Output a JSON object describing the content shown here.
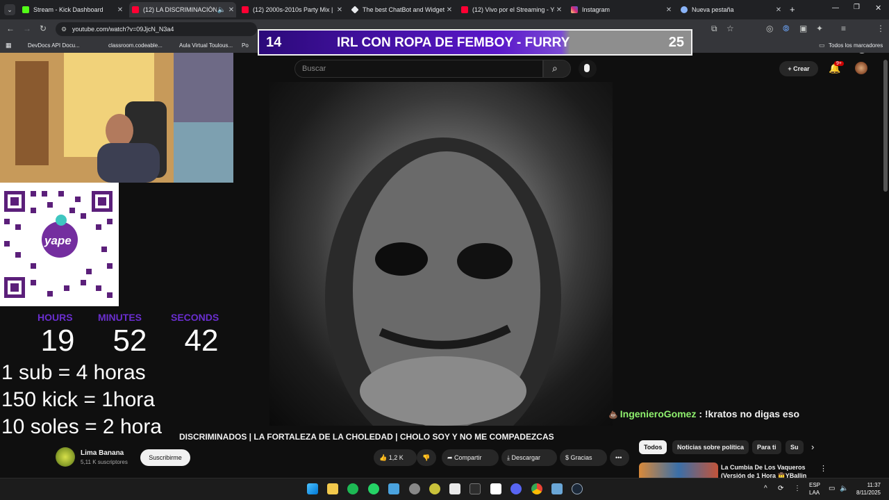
{
  "browser": {
    "tabs": [
      {
        "title": "Stream - Kick Dashboard",
        "active": false,
        "favicon_color": "#53fc18"
      },
      {
        "title": "(12) LA DISCRIMINACIÓN D",
        "active": true,
        "favicon_color": "#ff0033"
      },
      {
        "title": "(12) 2000s-2010s Party Mix | - Y",
        "active": false,
        "favicon_color": "#ff0033"
      },
      {
        "title": "The best ChatBot and Widgets",
        "active": false,
        "favicon_color": "#e8eaed"
      },
      {
        "title": "(12) Vivo por el Streaming - Yo",
        "active": false,
        "favicon_color": "#ff0033"
      },
      {
        "title": "Instagram",
        "active": false,
        "favicon_color": "#e1306c"
      },
      {
        "title": "Nueva pestaña",
        "active": false,
        "favicon_color": "#8ab4f8"
      }
    ],
    "url": "youtube.com/watch?v=09JjcN_N3a4",
    "bookmarks": [
      "DevDocs API Docu...",
      "classroom.codeable...",
      "Aula Virtual Toulous...",
      "Po"
    ],
    "all_bookmarks": "Todos los marcadores"
  },
  "overlay": {
    "banner_left": "14",
    "banner_title": "IRL CON ROPA DE FEMBOY - FURRY",
    "banner_right": "25",
    "qr_brand": "yape",
    "timer": {
      "hours_label": "HOURS",
      "minutes_label": "MINUTES",
      "seconds_label": "SECONDS",
      "hours": "19",
      "minutes": "52",
      "seconds": "42"
    },
    "rules": [
      "1 sub = 4 horas",
      "150 kick = 1hora",
      "10 soles = 2 hora"
    ],
    "chat": {
      "user": "IngenieroGomez",
      "message": ": !kratos no digas eso"
    }
  },
  "youtube": {
    "search_placeholder": "Buscar",
    "create_label": "Crear",
    "notifications": "9+",
    "video_title": "DISCRIMINADOS | LA FORTALEZA DE LA CHOLEDAD | CHOLO SOY Y NO ME COMPADEZCAS",
    "channel_name": "Lima Banana",
    "channel_subs": "5,11 K suscriptores",
    "subscribe_label": "Suscribirme",
    "likes": "1,2 K",
    "share_label": "Compartir",
    "download_label": "Descargar",
    "thanks_label": "Gracias",
    "chips": [
      "Todos",
      "Noticias sobre política",
      "Para ti",
      "Su"
    ],
    "rec_title_1": "La Cumbia De Los Vaqueros",
    "rec_title_2": "(Versión de 1 Hora 🤠YBallin"
  },
  "taskbar": {
    "lang_1": "ESP",
    "lang_2": "LAA",
    "time": "11:37",
    "date": "8/11/2025"
  }
}
